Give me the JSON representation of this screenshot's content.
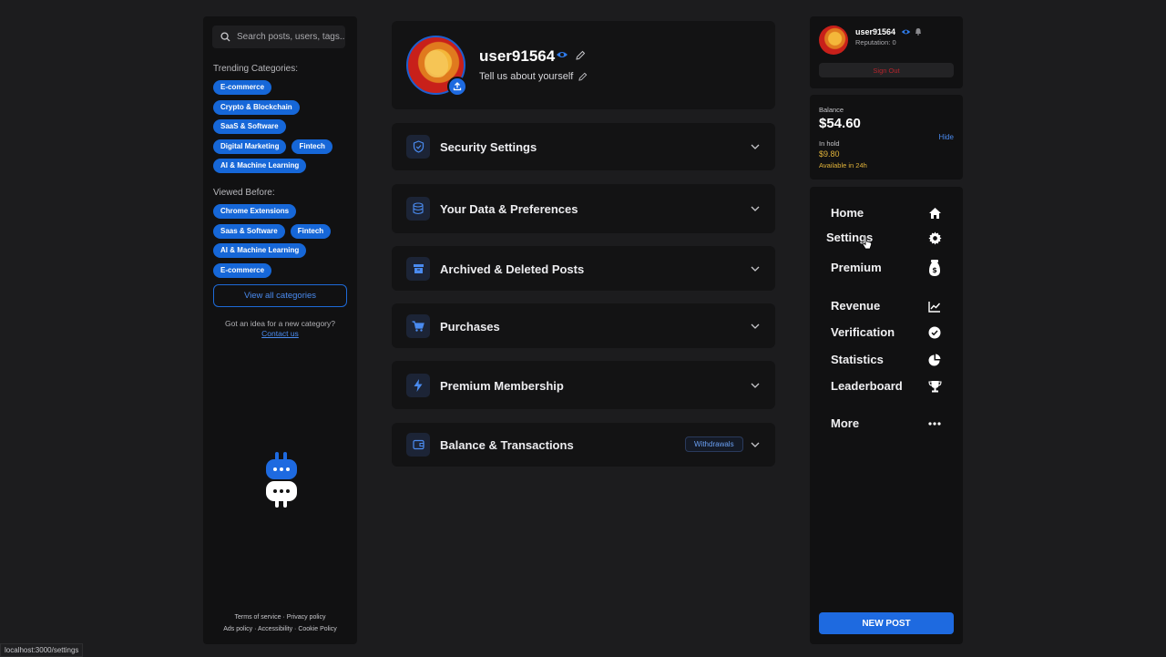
{
  "left_sidebar": {
    "search_placeholder": "Search posts, users, tags...",
    "trending_label": "Trending Categories:",
    "trending": [
      [
        "E-commerce"
      ],
      [
        "Crypto & Blockchain"
      ],
      [
        "SaaS & Software"
      ],
      [
        "Digital Marketing",
        "Fintech"
      ],
      [
        "AI & Machine Learning"
      ]
    ],
    "viewed_label": "Viewed Before:",
    "viewed": [
      [
        "Chrome Extensions"
      ],
      [
        "Saas & Software",
        "Fintech"
      ],
      [
        "AI & Machine Learning"
      ],
      [
        "E-commerce"
      ]
    ],
    "view_all": "View all categories",
    "idea_text": "Got an idea for a new category?",
    "contact": "Contact us",
    "footer_line1": "Terms of service · Privacy policy",
    "footer_line2": "Ads policy · Accessibility · Cookie Policy"
  },
  "profile": {
    "username": "user91564",
    "bio": "Tell us about yourself"
  },
  "sections": [
    {
      "title": "Security Settings",
      "icon": "shield-icon"
    },
    {
      "title": "Your Data & Preferences",
      "icon": "database-icon"
    },
    {
      "title": "Archived & Deleted Posts",
      "icon": "archive-icon"
    },
    {
      "title": "Purchases",
      "icon": "cart-icon"
    },
    {
      "title": "Premium Membership",
      "icon": "bolt-icon"
    },
    {
      "title": "Balance & Transactions",
      "icon": "wallet-icon",
      "badge": "Withdrawals"
    }
  ],
  "user_panel": {
    "username": "user91564",
    "reputation": "Reputation: 0",
    "sign_out": "Sign Out"
  },
  "balance": {
    "label": "Balance",
    "amount": "$54.60",
    "hold_label": "In hold",
    "hold_amount": "$9.80",
    "available": "Available in 24h",
    "hide": "Hide"
  },
  "nav": [
    {
      "label": "Home",
      "icon": "home-icon"
    },
    {
      "label": "Settings",
      "icon": "gear-icon"
    },
    {
      "label": "Premium",
      "icon": "money-bag-icon"
    },
    {
      "label": "Revenue",
      "icon": "chart-line-icon"
    },
    {
      "label": "Verification",
      "icon": "check-circle-icon"
    },
    {
      "label": "Statistics",
      "icon": "pie-chart-icon"
    },
    {
      "label": "Leaderboard",
      "icon": "trophy-icon"
    },
    {
      "label": "More",
      "icon": "dots-icon"
    }
  ],
  "new_post": "NEW POST",
  "status_url": "localhost:3000/settings",
  "colors": {
    "accent": "#1e6ae0",
    "tag": "#1667d8",
    "gold": "#e2b43a",
    "danger": "#b4242c"
  }
}
